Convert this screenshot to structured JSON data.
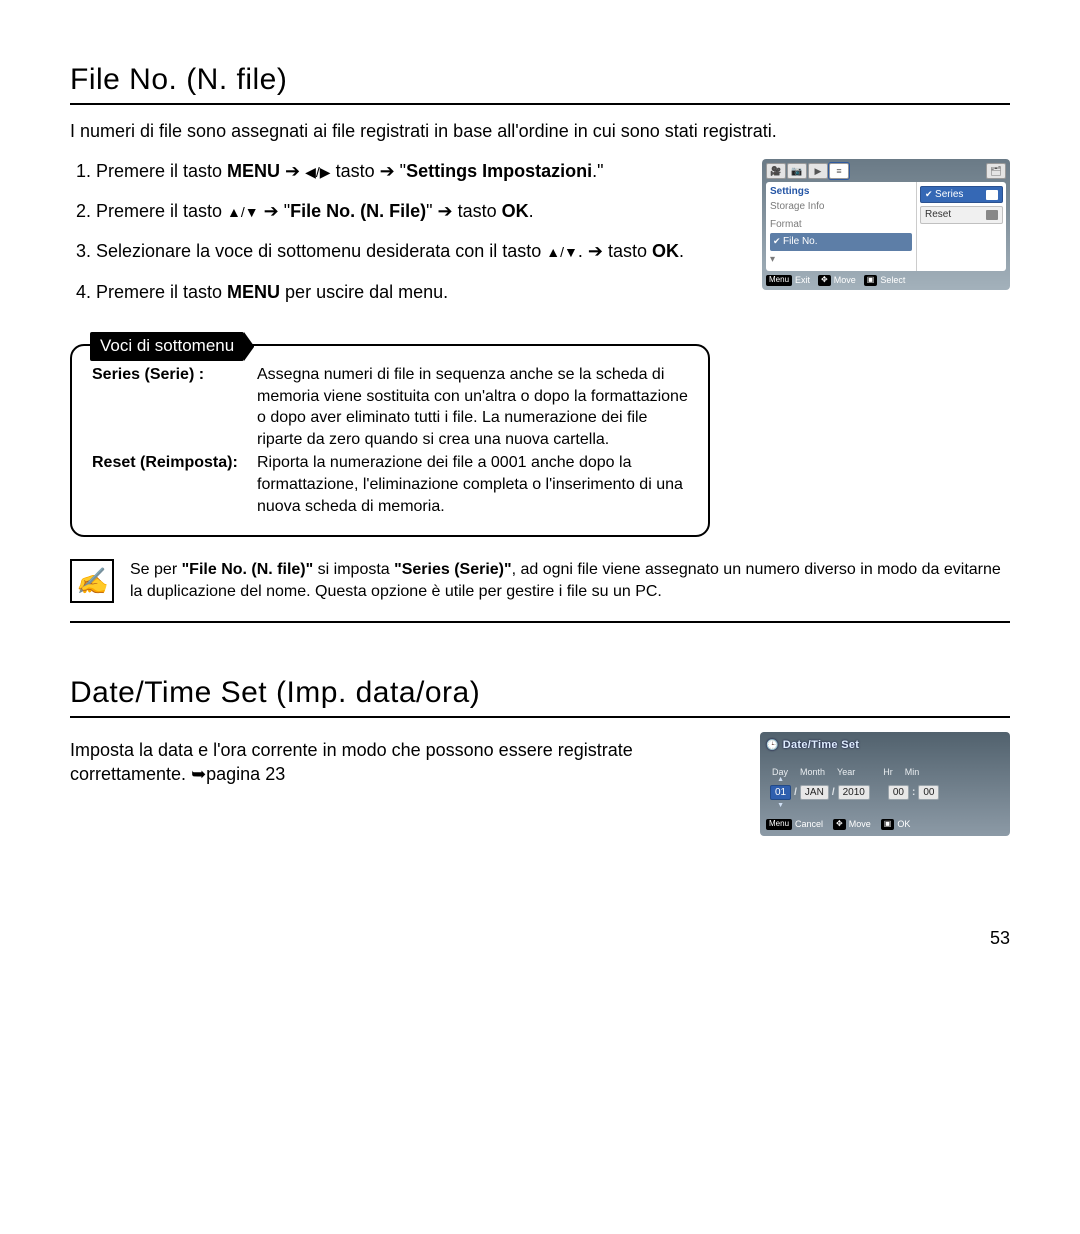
{
  "section1": {
    "title": "File No. (N. file)",
    "intro": "I numeri di file sono assegnati ai file registrati in base all'ordine in cui sono stati registrati.",
    "steps": {
      "s1_a": "Premere il tasto ",
      "s1_menu": "MENU",
      "s1_b": " ➔ ",
      "s1_c": " tasto ➔ \"",
      "s1_bold": "Settings Impostazioni",
      "s1_d": ".\"",
      "s2_a": "Premere il tasto ",
      "s2_arrows": " ➔ \"",
      "s2_bold": "File No. (N. File)",
      "s2_b": "\" ➔ tasto ",
      "s2_ok": "OK",
      "s2_c": ".",
      "s3_a": "Selezionare la voce di sottomenu desiderata con il tasto ",
      "s3_b": ". ➔ tasto ",
      "s3_ok": "OK",
      "s3_c": ".",
      "s4_a": "Premere il tasto ",
      "s4_menu": "MENU",
      "s4_b": " per uscire dal menu."
    },
    "screen": {
      "settings": "Settings",
      "items": {
        "a": "Storage Info",
        "b": "Format",
        "c": "File No.",
        "d": ""
      },
      "opts": {
        "a": "Series",
        "b": "Reset"
      },
      "bar": {
        "menu": "Menu",
        "exit": "Exit",
        "moveIcon": "✥",
        "move": "Move",
        "selIcon": "▣",
        "select": "Select"
      }
    },
    "submenu": {
      "label": "Voci di sottomenu",
      "series_t": "Series (Serie) :",
      "series_d": "Assegna numeri di file in sequenza anche se la scheda di memoria viene sostituita con un'altra o dopo la formattazione o dopo aver eliminato tutti i file. La numerazione dei file riparte da zero quando si crea una nuova cartella.",
      "reset_t": "Reset (Reimposta):",
      "reset_d": "Riporta la numerazione dei file a 0001 anche dopo la formattazione, l'eliminazione completa o l'inserimento di una nuova scheda di memoria."
    },
    "note_a": "Se per ",
    "note_b": "\"File No. (N. file)\"",
    "note_c": " si imposta ",
    "note_d": "\"Series (Serie)\"",
    "note_e": ", ad ogni file viene assegnato un numero diverso in modo da evitarne la duplicazione del nome. Questa opzione è utile per gestire i file su un PC."
  },
  "section2": {
    "title": "Date/Time Set (Imp. data/ora)",
    "intro_a": "Imposta la data e l'ora corrente in modo che possono essere registrate correttamente. ",
    "intro_b": "➥pagina 23",
    "screen": {
      "title": "Date/Time Set",
      "hdr": {
        "day": "Day",
        "month": "Month",
        "year": "Year",
        "hr": "Hr",
        "min": "Min"
      },
      "val": {
        "day": "01",
        "month": "JAN",
        "year": "2010",
        "hr": "00",
        "min": "00"
      },
      "bar": {
        "menu": "Menu",
        "cancel": "Cancel",
        "moveIcon": "✥",
        "move": "Move",
        "okIcon": "▣",
        "ok": "OK"
      }
    }
  },
  "page": "53"
}
